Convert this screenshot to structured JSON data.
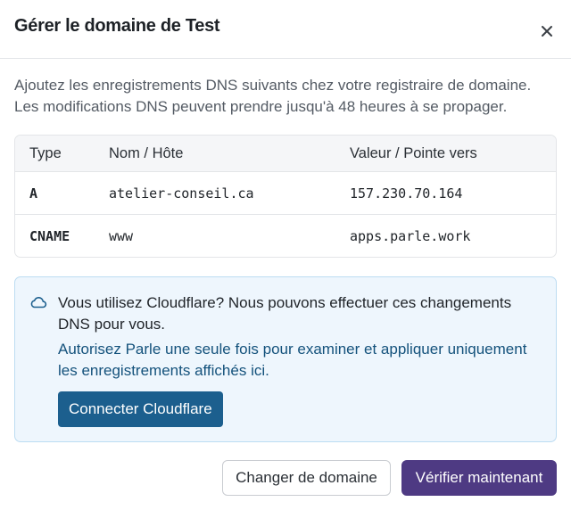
{
  "dialog": {
    "title": "Gérer le domaine de Test",
    "description": "Ajoutez les enregistrements DNS suivants chez votre registraire de domaine. Les modifications DNS peuvent prendre jusqu'à 48 heures à se propager."
  },
  "table": {
    "headers": {
      "type": "Type",
      "name": "Nom / Hôte",
      "value": "Valeur / Pointe vers"
    },
    "rows": [
      {
        "type": "A",
        "name": "atelier-conseil.ca",
        "value": "157.230.70.164"
      },
      {
        "type": "CNAME",
        "name": "www",
        "value": "apps.parle.work"
      }
    ]
  },
  "cloudflare": {
    "title": "Vous utilisez Cloudflare? Nous pouvons effectuer ces changements DNS pour vous.",
    "note": "Autorisez Parle une seule fois pour examiner et appliquer uniquement les enregistrements affichés ici.",
    "button_label": "Connecter Cloudflare",
    "icon": "cloud-icon"
  },
  "footer": {
    "change_label": "Changer de domaine",
    "verify_label": "Vérifier maintenant"
  },
  "colors": {
    "primary": "#4e3a83",
    "cloudflare_button": "#1c5f8e",
    "info_background": "#eef6fd",
    "info_border": "#bcdcf2"
  }
}
